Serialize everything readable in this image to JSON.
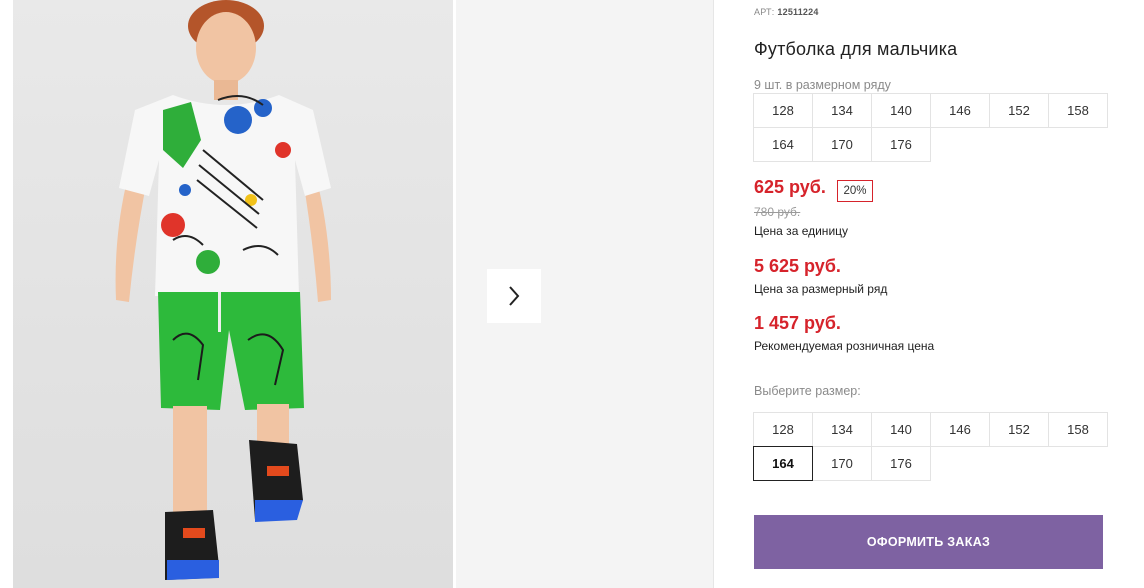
{
  "product": {
    "art_label": "АРТ:",
    "art_value": "12511224",
    "title": "Футболка для мальчика",
    "row_note": "9 шт. в размерном ряду",
    "row_sizes": [
      "128",
      "134",
      "140",
      "146",
      "152",
      "158",
      "164",
      "170",
      "176"
    ],
    "price_unit": "625 руб.",
    "discount": "20%",
    "price_old": "780 руб.",
    "price_unit_label": "Цена за единицу",
    "price_row": "5 625 руб.",
    "price_row_label": "Цена за размерный ряд",
    "price_retail": "1 457 руб.",
    "price_retail_label": "Рекомендуемая розничная цена",
    "choose_label": "Выберите размер:",
    "choose_sizes": [
      "128",
      "134",
      "140",
      "146",
      "152",
      "158",
      "164",
      "170",
      "176"
    ],
    "selected_size": "164",
    "order_button": "ОФОРМИТЬ ЗАКАЗ"
  },
  "gallery": {
    "image_alt": "boy-in-graffiti-tshirt-photo",
    "next_icon": "chevron-right-icon"
  },
  "colors": {
    "price": "#d6232b",
    "button": "#7e62a2"
  }
}
